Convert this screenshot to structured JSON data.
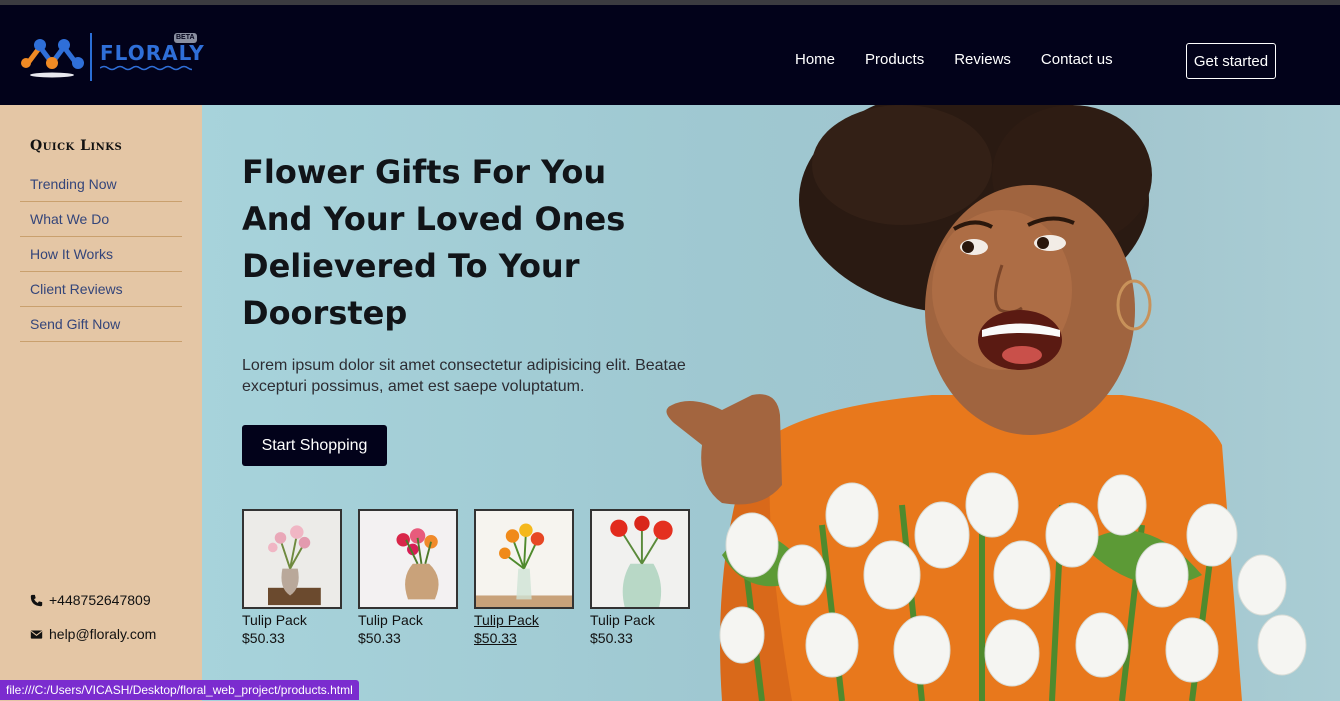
{
  "brand": {
    "name": "FLORALY",
    "badge": "BETA"
  },
  "nav": {
    "items": [
      "Home",
      "Products",
      "Reviews",
      "Contact us"
    ],
    "cta": "Get started"
  },
  "sidebar": {
    "title": "Quick Links",
    "links": [
      "Trending Now",
      "What We Do",
      "How It Works",
      "Client Reviews",
      "Send Gift Now"
    ],
    "phone": "+448752647809",
    "email": "help@floraly.com"
  },
  "hero": {
    "title": "Flower Gifts For You And Your Loved Ones Delievered To Your Doorstep",
    "description": "Lorem ipsum dolor sit amet consectetur adipisicing elit. Beatae excepturi possimus, amet est saepe voluptatum.",
    "button": "Start Shopping"
  },
  "products": [
    {
      "name": "Tulip Pack",
      "price": "$50.33"
    },
    {
      "name": "Tulip Pack",
      "price": "$50.33"
    },
    {
      "name": "Tulip Pack",
      "price": "$50.33"
    },
    {
      "name": "Tulip Pack",
      "price": "$50.33"
    }
  ],
  "status_bar": {
    "url": "file:///C:/Users/VICASH/Desktop/floral_web_project/products.html"
  },
  "colors": {
    "header_bg": "#02021a",
    "sidebar_bg": "#e4c6a5",
    "accent": "#2f6fd8",
    "hero_bg": "#a7d3db"
  }
}
